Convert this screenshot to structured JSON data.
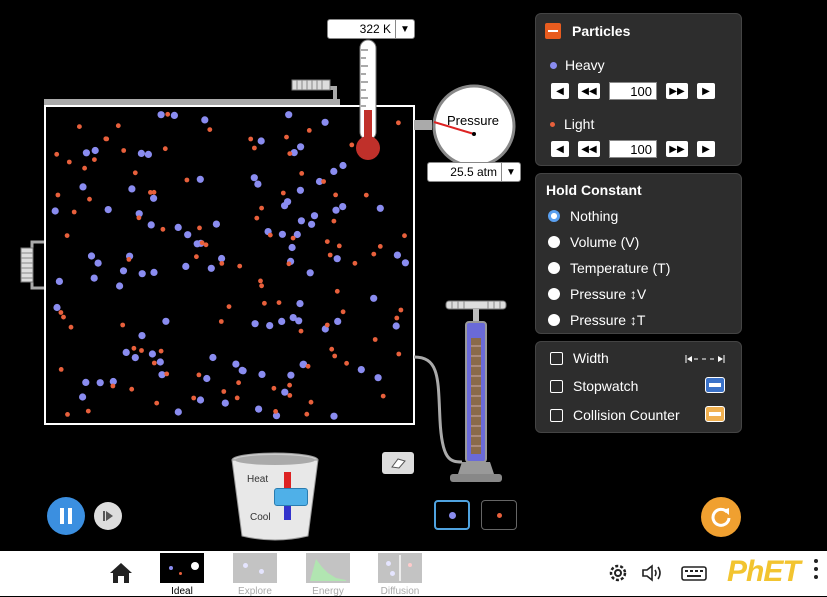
{
  "thermometer": {
    "value": "322 K"
  },
  "pressure_gauge": {
    "label": "Pressure",
    "value": "25.5 atm"
  },
  "particles_panel": {
    "title": "Particles",
    "heavy": {
      "label": "Heavy",
      "count": "100"
    },
    "light": {
      "label": "Light",
      "count": "100"
    }
  },
  "hold_constant": {
    "title": "Hold Constant",
    "options": [
      "Nothing",
      "Volume (V)",
      "Temperature (T)",
      "Pressure ↕V",
      "Pressure ↕T"
    ],
    "selected": "Nothing"
  },
  "tools_panel": {
    "width": "Width",
    "stopwatch": "Stopwatch",
    "collision_counter": "Collision Counter"
  },
  "heater": {
    "heat_label": "Heat",
    "cool_label": "Cool"
  },
  "nav": {
    "screens": [
      "Ideal",
      "Explore",
      "Energy",
      "Diffusion"
    ],
    "selected": "Ideal",
    "brand": "PhET"
  },
  "colors": {
    "heavy_particle": "#8a8cf0",
    "light_particle": "#e8603c",
    "panel_bg": "#2d2d2d",
    "accent_orange": "#f0a030",
    "pause_button": "#3b8fe0"
  },
  "icons": [
    "minus-icon",
    "step-back-icon",
    "fast-back-icon",
    "fast-forward-icon",
    "step-forward-icon",
    "home-icon",
    "settings-icon",
    "sound-icon",
    "keyboard-icon",
    "eraser-icon",
    "reset-icon",
    "pause-icon",
    "step-icon"
  ]
}
